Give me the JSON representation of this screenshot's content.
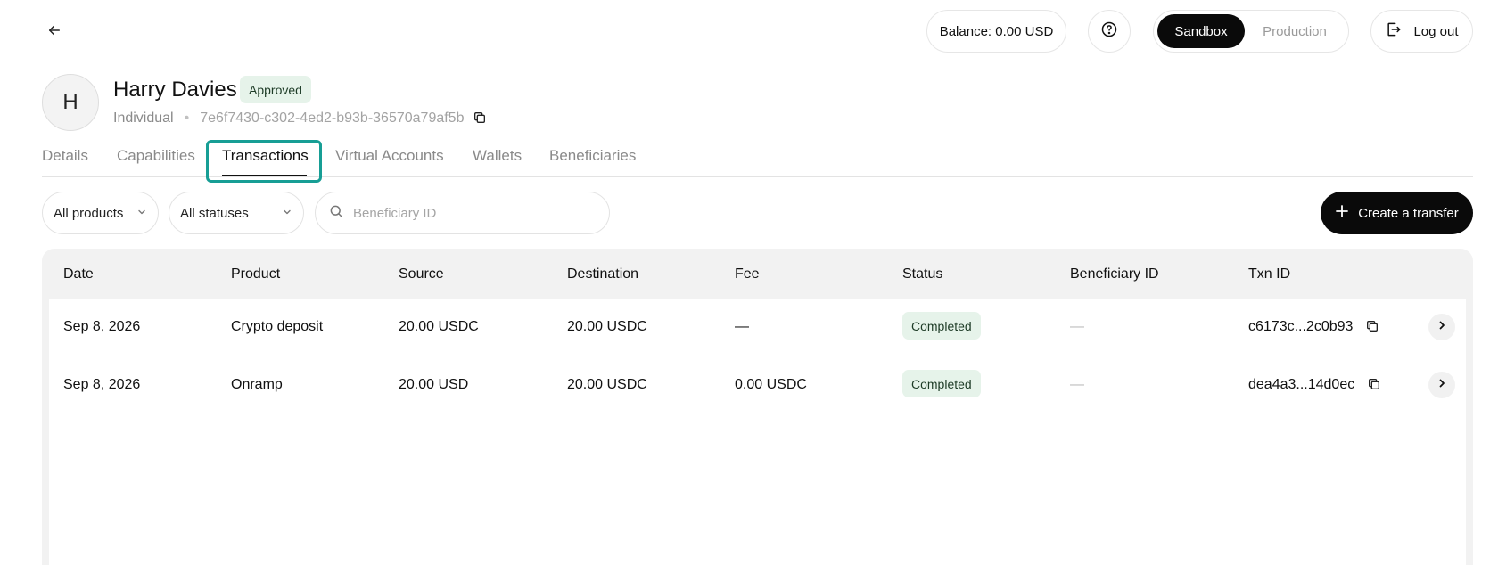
{
  "header": {
    "balance_label": "Balance: 0.00 USD",
    "env_options": [
      "Sandbox",
      "Production"
    ],
    "env_selected": "Sandbox",
    "logout_label": "Log out"
  },
  "profile": {
    "avatar_initial": "H",
    "name": "Harry Davies",
    "status": "Approved",
    "type": "Individual",
    "separator": "•",
    "id": "7e6f7430-c302-4ed2-b93b-36570a79af5b"
  },
  "tabs": [
    {
      "label": "Details"
    },
    {
      "label": "Capabilities"
    },
    {
      "label": "Transactions"
    },
    {
      "label": "Virtual Accounts"
    },
    {
      "label": "Wallets"
    },
    {
      "label": "Beneficiaries"
    }
  ],
  "active_tab": "Transactions",
  "filters": {
    "products_label": "All products",
    "statuses_label": "All statuses",
    "search_placeholder": "Beneficiary ID"
  },
  "create_transfer_label": "Create a transfer",
  "table": {
    "columns": [
      "Date",
      "Product",
      "Source",
      "Destination",
      "Fee",
      "Status",
      "Beneficiary ID",
      "Txn ID"
    ],
    "rows": [
      {
        "date": "Sep 8, 2026",
        "product": "Crypto deposit",
        "source": "20.00 USDC",
        "destination": "20.00 USDC",
        "fee": "—",
        "status": "Completed",
        "beneficiary_id": "—",
        "txn_id": "c6173c...2c0b93"
      },
      {
        "date": "Sep 8, 2026",
        "product": "Onramp",
        "source": "20.00 USD",
        "destination": "20.00 USDC",
        "fee": "0.00 USDC",
        "status": "Completed",
        "beneficiary_id": "—",
        "txn_id": "dea4a3...14d0ec"
      }
    ]
  },
  "icons": {
    "back": "arrow-left-icon",
    "help": "question-circle-icon",
    "logout": "logout-icon",
    "copy": "copy-icon",
    "chevron_down": "chevron-down-icon",
    "search": "search-icon",
    "plus": "plus-icon",
    "chevron_right": "chevron-right-icon"
  },
  "colors": {
    "accent_highlight": "#179e95",
    "primary_dark": "#0a0a0a",
    "success_badge_bg": "#e6f3ea"
  }
}
